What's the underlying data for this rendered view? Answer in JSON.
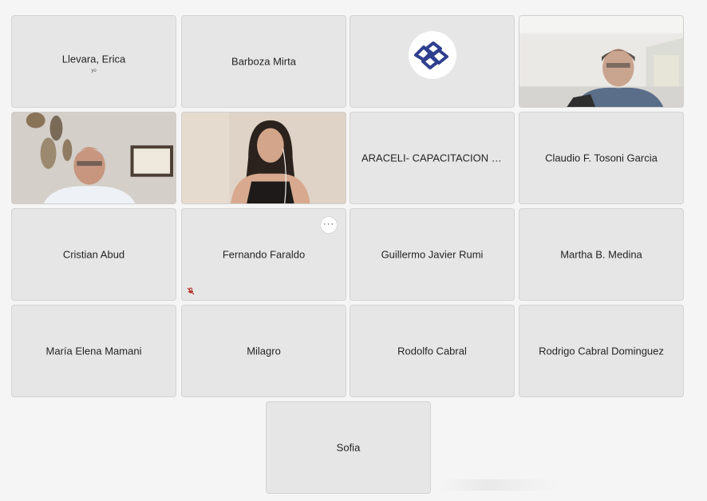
{
  "participants": [
    {
      "name": "Llevara, Erica",
      "sub": "yo"
    },
    {
      "name": "Barboza Mirta"
    },
    {
      "name": "ARACELI- CAPACITACION CPCE-LP"
    },
    {
      "name": "Claudio F. Tosoni Garcia"
    },
    {
      "name": "Cristian Abud"
    },
    {
      "name": "Fernando Faraldo",
      "more_label": "···"
    },
    {
      "name": "Guillermo Javier Rumi"
    },
    {
      "name": "Martha B. Medina"
    },
    {
      "name": "María Elena Mamani"
    },
    {
      "name": "Milagro"
    },
    {
      "name": "Rodolfo Cabral"
    },
    {
      "name": "Rodrigo Cabral Dominguez"
    },
    {
      "name": "Sofia"
    }
  ],
  "icons": {
    "logo": "cpce-logo-icon",
    "more": "more-options-icon",
    "mic_off": "mic-off-icon"
  },
  "colors": {
    "tile_bg": "#e6e6e6",
    "logo_blue": "#2f3f8f",
    "mic_off_red": "#b3261e"
  }
}
